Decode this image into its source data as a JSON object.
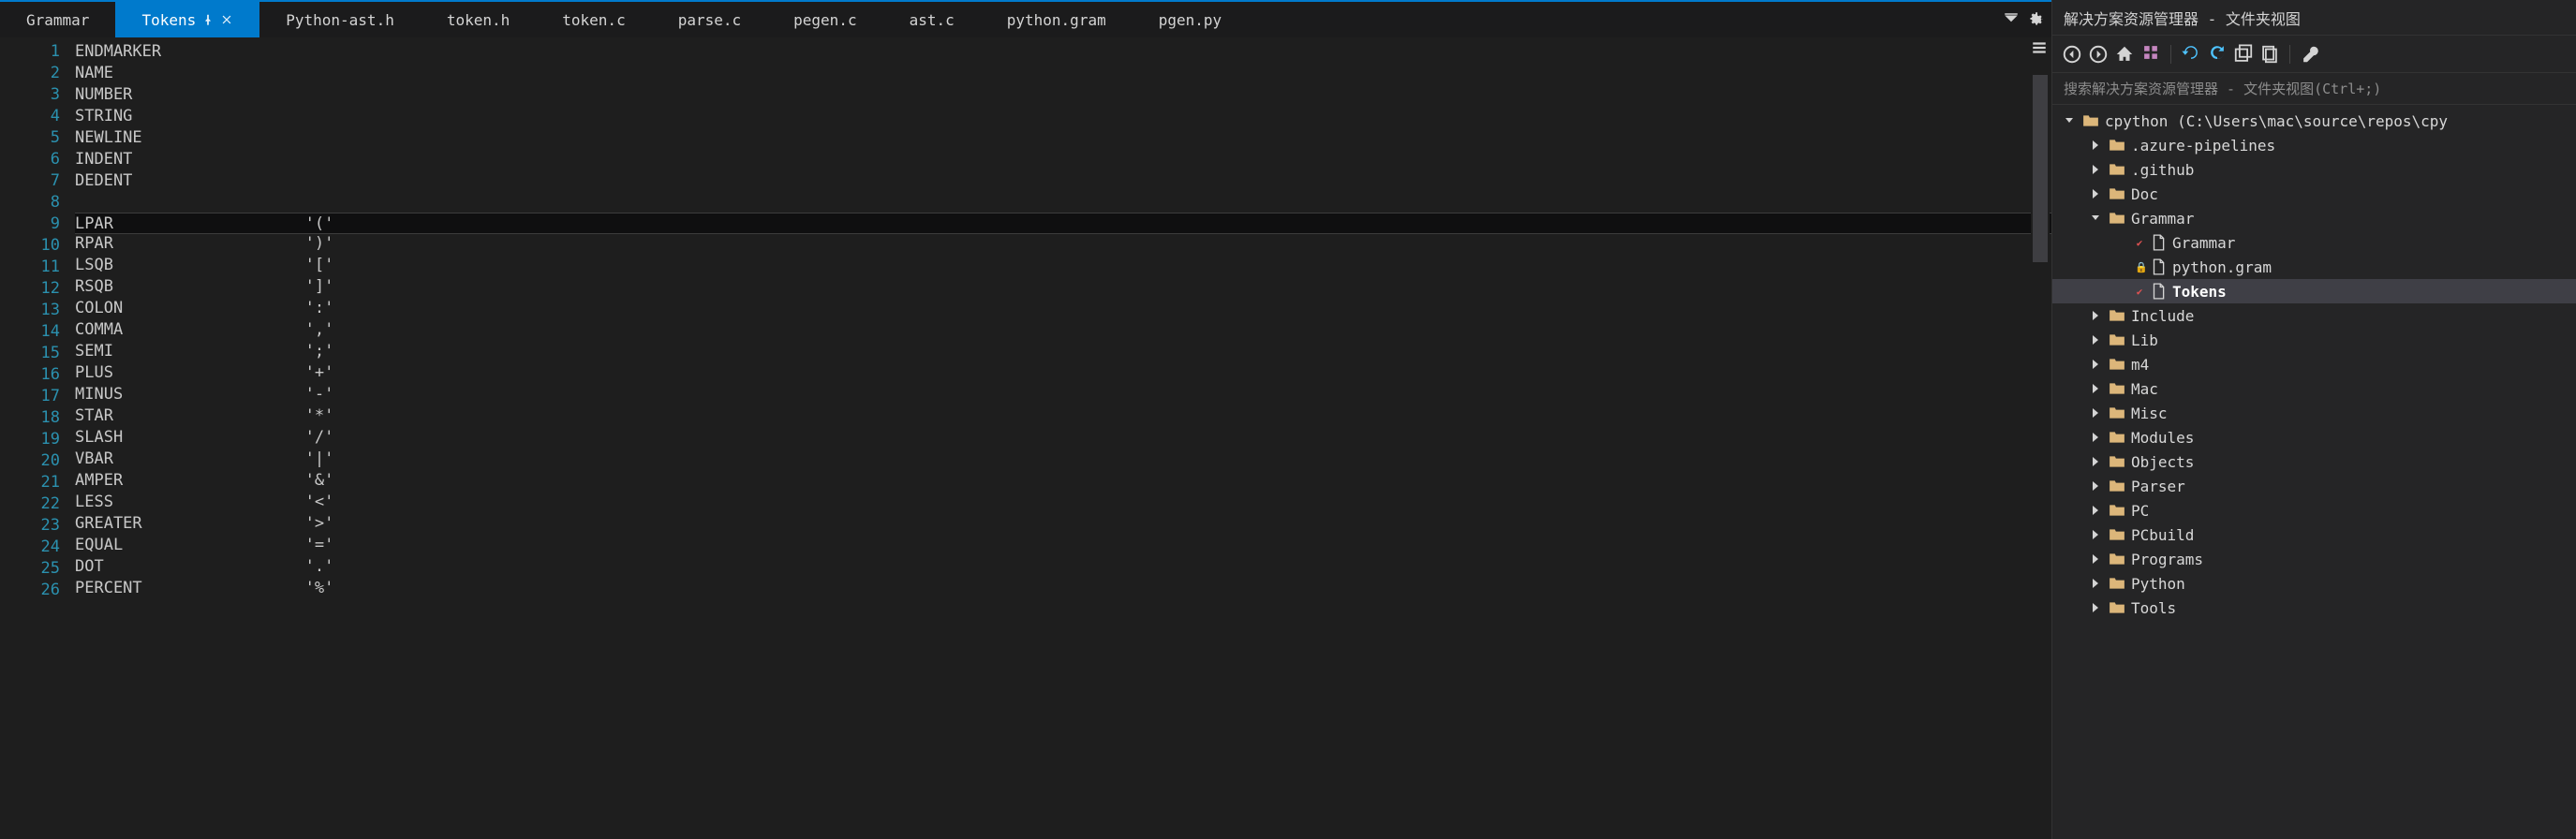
{
  "tabs": [
    {
      "label": "Grammar"
    },
    {
      "label": "Tokens",
      "active": true,
      "pinned": true,
      "closable": true
    },
    {
      "label": "Python-ast.h"
    },
    {
      "label": "token.h"
    },
    {
      "label": "token.c"
    },
    {
      "label": "parse.c"
    },
    {
      "label": "pegen.c"
    },
    {
      "label": "ast.c"
    },
    {
      "label": "python.gram"
    },
    {
      "label": "pgen.py"
    }
  ],
  "editor": {
    "cursor_line": 9,
    "lines": [
      "ENDMARKER",
      "NAME",
      "NUMBER",
      "STRING",
      "NEWLINE",
      "INDENT",
      "DEDENT",
      "",
      "LPAR                    '('",
      "RPAR                    ')'",
      "LSQB                    '['",
      "RSQB                    ']'",
      "COLON                   ':'",
      "COMMA                   ','",
      "SEMI                    ';'",
      "PLUS                    '+'",
      "MINUS                   '-'",
      "STAR                    '*'",
      "SLASH                   '/'",
      "VBAR                    '|'",
      "AMPER                   '&'",
      "LESS                    '<'",
      "GREATER                 '>'",
      "EQUAL                   '='",
      "DOT                     '.'",
      "PERCENT                 '%'"
    ]
  },
  "solution": {
    "title": "解决方案资源管理器 - 文件夹视图",
    "search_placeholder": "搜索解决方案资源管理器 - 文件夹视图(Ctrl+;)",
    "root": {
      "label": "cpython (C:\\Users\\mac\\source\\repos\\cpy"
    },
    "nodes": [
      {
        "depth": 1,
        "expand": "closed",
        "icon": "folder",
        "label": ".azure-pipelines"
      },
      {
        "depth": 1,
        "expand": "closed",
        "icon": "folder",
        "label": ".github"
      },
      {
        "depth": 1,
        "expand": "closed",
        "icon": "folder",
        "label": "Doc"
      },
      {
        "depth": 1,
        "expand": "open",
        "icon": "folder",
        "label": "Grammar"
      },
      {
        "depth": 2,
        "expand": "none",
        "icon": "file",
        "badge": "red",
        "label": "Grammar"
      },
      {
        "depth": 2,
        "expand": "none",
        "icon": "file",
        "badge": "blue",
        "label": "python.gram"
      },
      {
        "depth": 2,
        "expand": "none",
        "icon": "file",
        "badge": "red",
        "label": "Tokens",
        "selected": true,
        "bold": true
      },
      {
        "depth": 1,
        "expand": "closed",
        "icon": "folder",
        "label": "Include"
      },
      {
        "depth": 1,
        "expand": "closed",
        "icon": "folder",
        "label": "Lib"
      },
      {
        "depth": 1,
        "expand": "closed",
        "icon": "folder",
        "label": "m4"
      },
      {
        "depth": 1,
        "expand": "closed",
        "icon": "folder",
        "label": "Mac"
      },
      {
        "depth": 1,
        "expand": "closed",
        "icon": "folder",
        "label": "Misc"
      },
      {
        "depth": 1,
        "expand": "closed",
        "icon": "folder",
        "label": "Modules"
      },
      {
        "depth": 1,
        "expand": "closed",
        "icon": "folder",
        "label": "Objects"
      },
      {
        "depth": 1,
        "expand": "closed",
        "icon": "folder",
        "label": "Parser"
      },
      {
        "depth": 1,
        "expand": "closed",
        "icon": "folder",
        "label": "PC"
      },
      {
        "depth": 1,
        "expand": "closed",
        "icon": "folder",
        "label": "PCbuild"
      },
      {
        "depth": 1,
        "expand": "closed",
        "icon": "folder",
        "label": "Programs"
      },
      {
        "depth": 1,
        "expand": "closed",
        "icon": "folder",
        "label": "Python"
      },
      {
        "depth": 1,
        "expand": "closed",
        "icon": "folder",
        "label": "Tools"
      }
    ]
  }
}
